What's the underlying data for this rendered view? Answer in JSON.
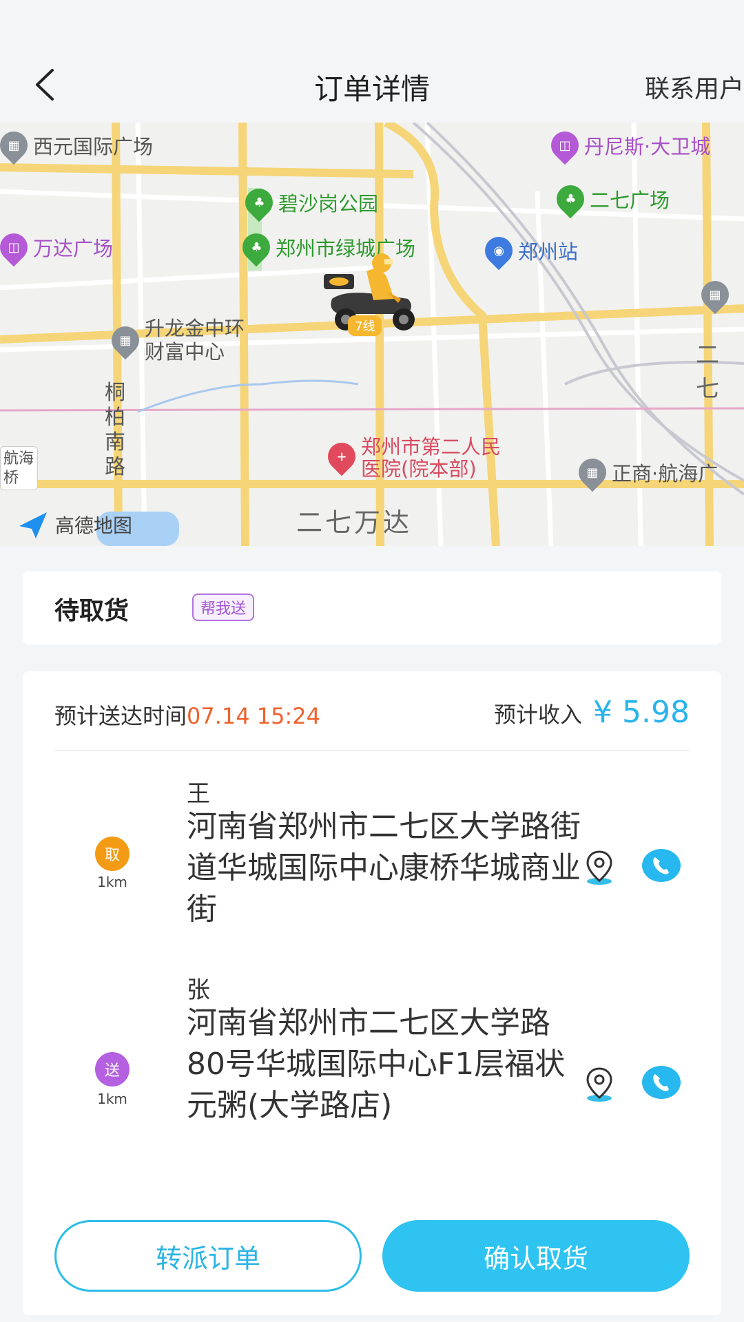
{
  "header": {
    "title": "订单详情",
    "contact_label": "联系用户"
  },
  "map": {
    "pois": {
      "xiyuan": "西元国际广场",
      "danis": "丹尼斯·大卫城",
      "bishagang": "碧沙岗公园",
      "erqi_square": "二七广场",
      "wanda": "万达广场",
      "lvcheng": "郑州市绿城广场",
      "zhengzhou_station": "郑州站",
      "shenglong_line1": "升龙金中环",
      "shenglong_line2": "财富中心",
      "hospital_line1": "郑州市第二人民",
      "hospital_line2": "医院(院本部)",
      "zhengshang": "正商·航海广",
      "erqi_partial": "二七"
    },
    "road_label": "桐柏南路",
    "district_label": "二七万达",
    "side_tag": "航海桥",
    "logo_text": "高德地图",
    "rider_tag": "7线"
  },
  "status": {
    "text": "待取货",
    "badge": "帮我送"
  },
  "detail": {
    "eta_label": "预计送达时间",
    "eta_value": "07.14 15:24",
    "income_label": "预计收入",
    "income_value": "¥ 5.98",
    "pickup": {
      "tag": "取",
      "distance": "1km",
      "name": "王",
      "address": "河南省郑州市二七区大学路街道华城国际中心康桥华城商业街"
    },
    "delivery": {
      "tag": "送",
      "distance": "1km",
      "name": "张",
      "address": "河南省郑州市二七区大学路80号华城国际中心F1层福状元粥(大学路店)"
    }
  },
  "actions": {
    "transfer_label": "转派订单",
    "confirm_label": "确认取货"
  },
  "colors": {
    "accent": "#2ec3f1",
    "eta": "#f0612d",
    "pickup_tag": "#f39b14",
    "delivery_tag": "#b460e0"
  }
}
